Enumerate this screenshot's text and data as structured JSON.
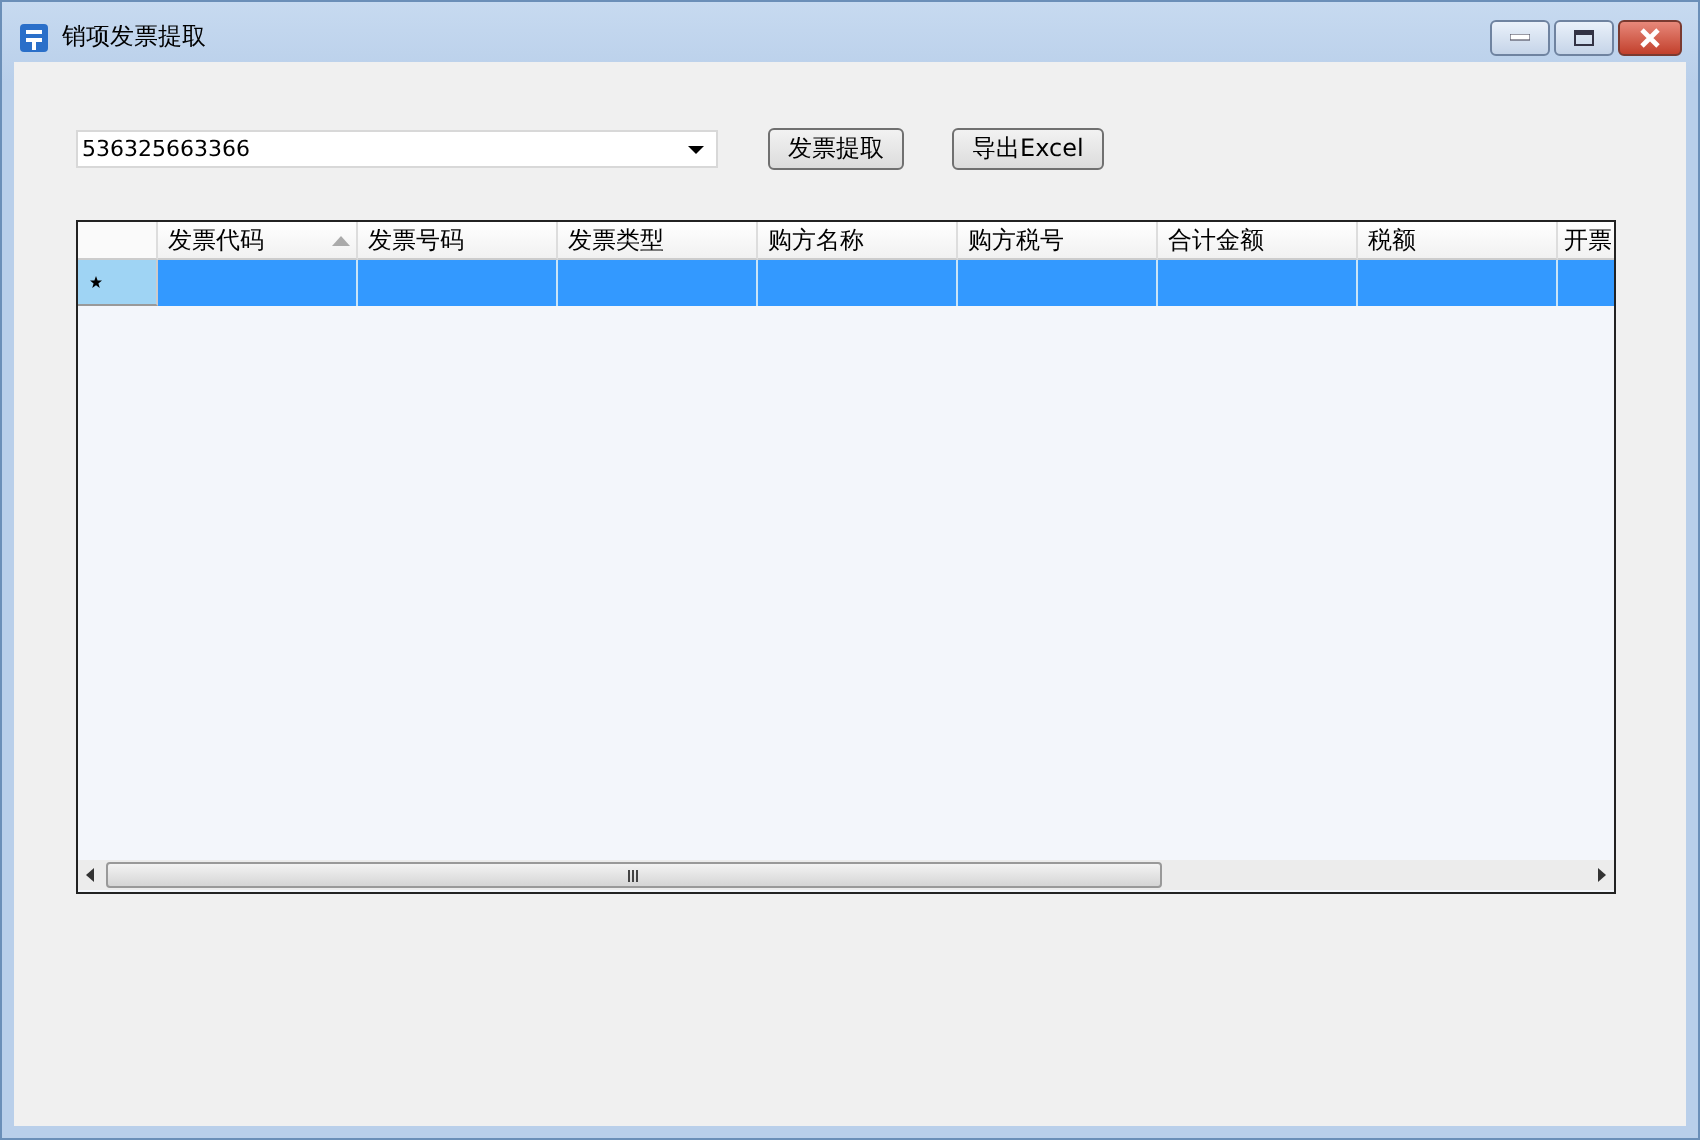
{
  "window": {
    "title": "销项发票提取"
  },
  "tax_number_combo": {
    "value": "536325663366"
  },
  "buttons": [
    "发票提取",
    "导出Excel"
  ],
  "table": {
    "columns": [
      {
        "label": "发票代码",
        "sorted": true
      },
      {
        "label": "发票号码",
        "sorted": false
      },
      {
        "label": "发票类型",
        "sorted": false
      },
      {
        "label": "购方名称",
        "sorted": false
      },
      {
        "label": "购方税号",
        "sorted": false
      },
      {
        "label": "合计金额",
        "sorted": false
      },
      {
        "label": "税额",
        "sorted": false
      },
      {
        "label": "开票",
        "sorted": false
      }
    ],
    "rows": [
      {
        "selected": true
      }
    ]
  }
}
